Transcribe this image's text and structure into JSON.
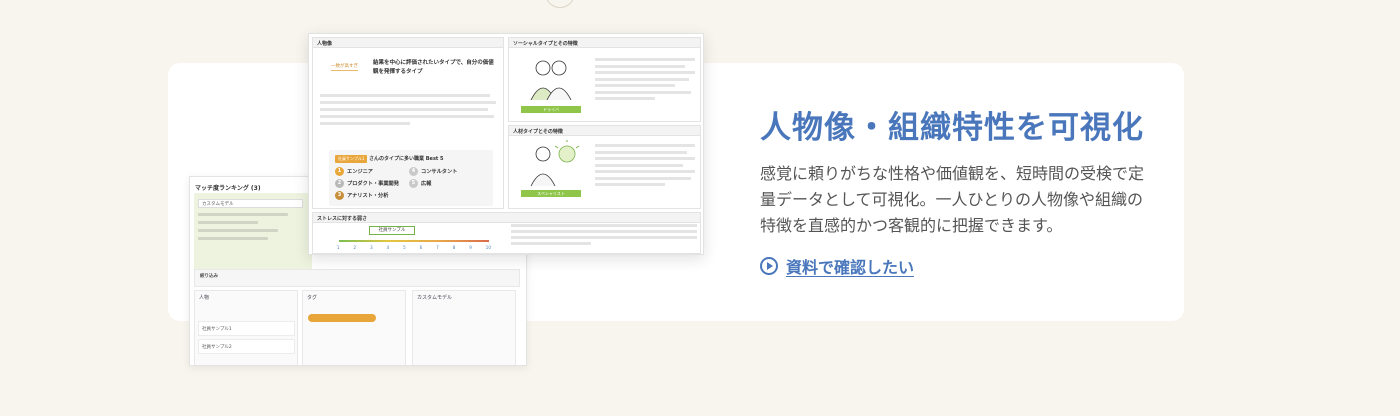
{
  "feature": {
    "heading": "人物像・組織特性を可視化",
    "description": "感覚に頼りがちな性格や価値観を、短時間の受検で定量データとして可視化。一人ひとりの人物像や組織の特徴を直感的かつ客観的に把握できます。",
    "link_label": "資料で確認したい"
  },
  "ranking_window": {
    "title": "マッチ度ランキング (3)",
    "select_value": "カスタムモデル",
    "section_title": "絞り込み",
    "columns": [
      {
        "label": "人物",
        "rows": [
          "社員サンプル1",
          "社員サンプル2"
        ]
      },
      {
        "label": "タグ",
        "rows": []
      },
      {
        "label": "カスタムモデル",
        "rows": []
      }
    ]
  },
  "report_window": {
    "person_panel": {
      "title": "人物像",
      "tag": "一致が高すぎ",
      "headline": "結果を中心に評価されたいタイプで、自分の価値観を発揮するタイプ",
      "best": {
        "tag": "社員サンプル1",
        "title": "さんのタイプに多い職業 Best 5",
        "items": [
          "エンジニア",
          "コンサルタント",
          "プロダクト・事業開発",
          "広報",
          "アナリスト・分析"
        ]
      }
    },
    "social_panel": {
      "title": "ソーシャルタイプとその特徴",
      "label": "ドライバ"
    },
    "human_panel": {
      "title": "人材タイプとその特徴",
      "label": "スペシャリスト"
    },
    "stress_panel": {
      "title": "ストレスに対する弱さ",
      "chip": "社員サンプル",
      "scale": [
        "1",
        "2",
        "3",
        "4",
        "5",
        "6",
        "7",
        "8",
        "9",
        "10"
      ]
    }
  },
  "colors": {
    "accent": "#4a77bc",
    "background": "#f8f5ee",
    "card": "#ffffff",
    "badge": "#e9a63b",
    "type_green": "#8fc64a"
  }
}
